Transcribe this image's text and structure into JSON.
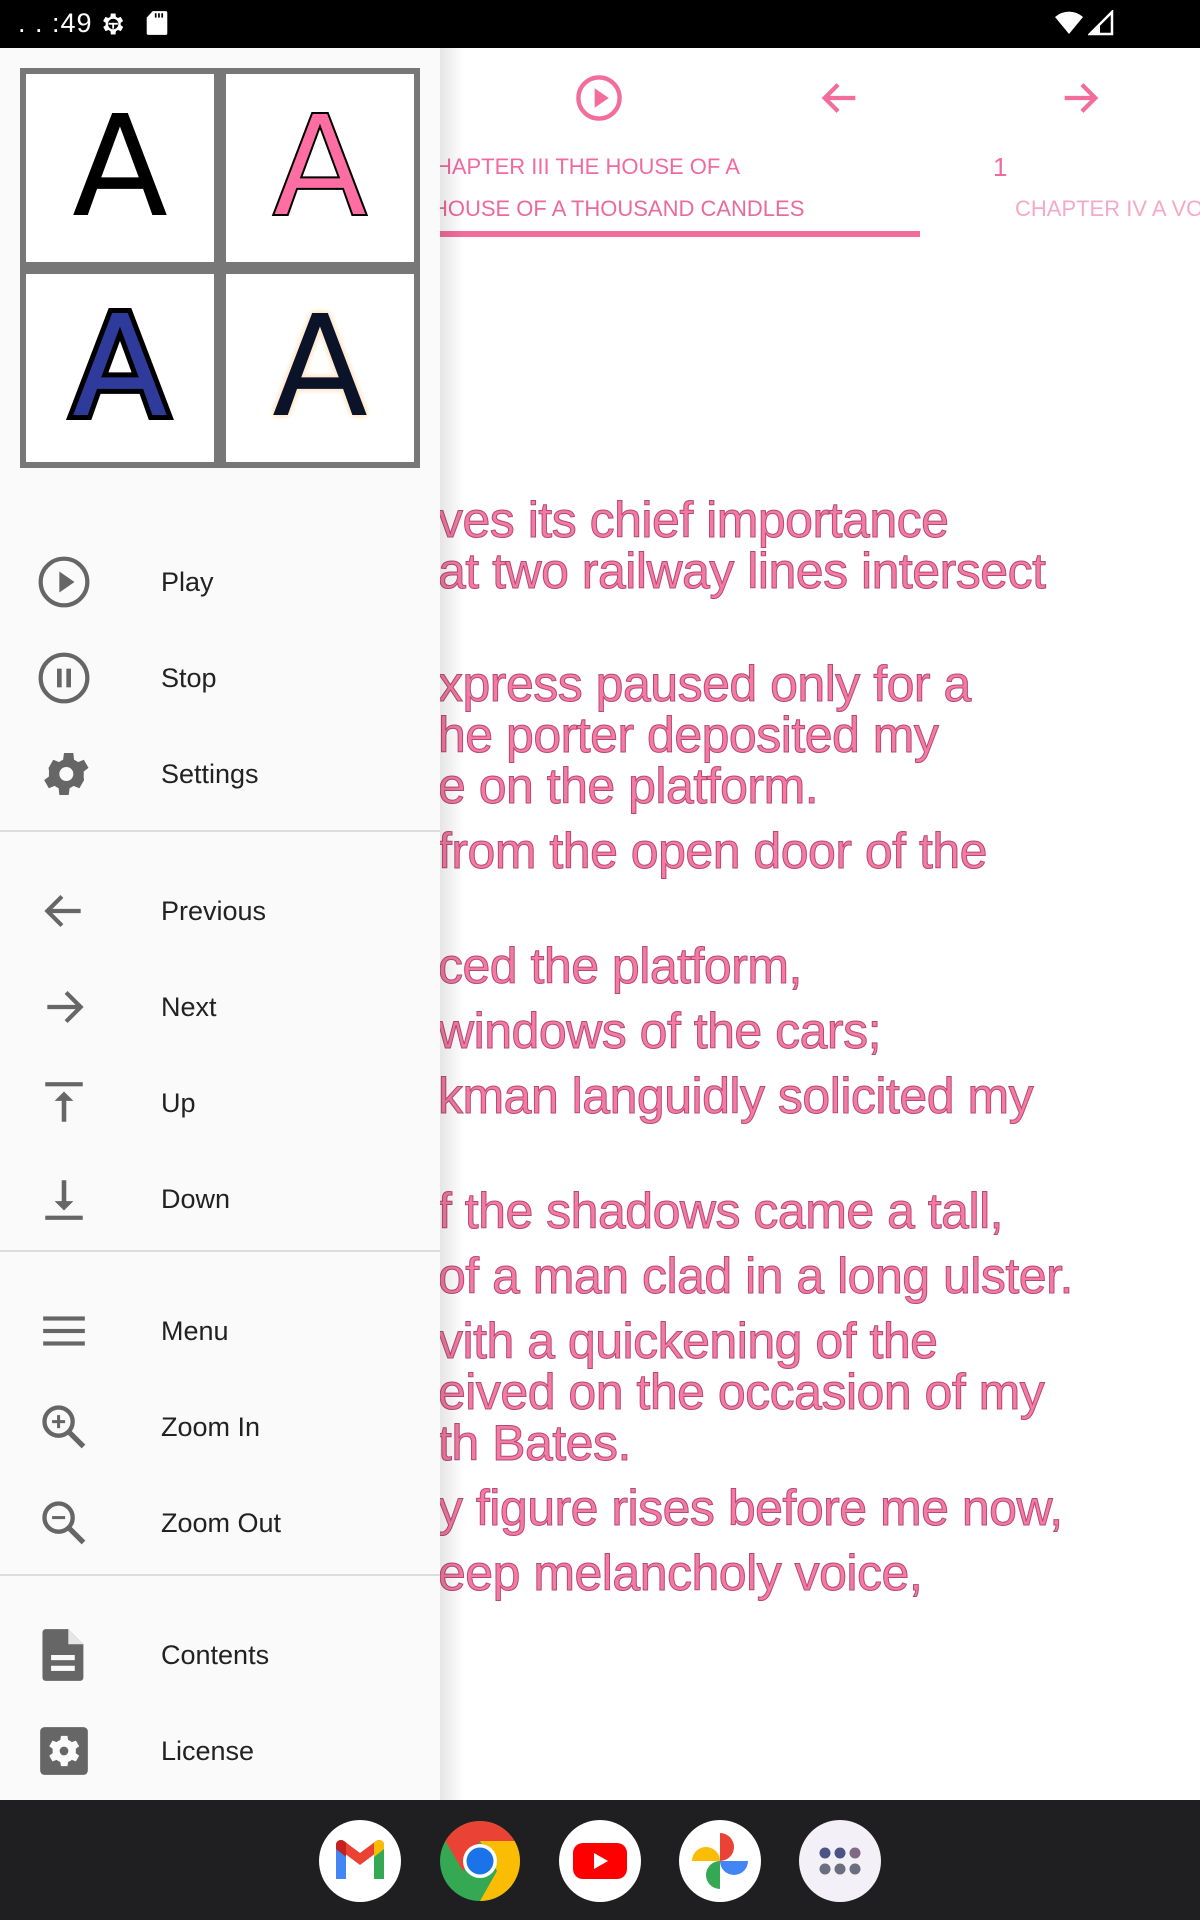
{
  "status_bar": {
    "time": ". . :49",
    "icons": [
      "settings-gear-icon",
      "sd-card-icon",
      "wifi-icon",
      "cell-signal-icon"
    ]
  },
  "reader": {
    "toolbar": {
      "play_icon": "play-circle-icon",
      "previous_icon": "arrow-left-icon",
      "next_icon": "arrow-right-icon"
    },
    "chapter_title": "CHAPTER III THE HOUSE OF A THOUSAND CANDLES",
    "page_number": "1",
    "tabs": [
      {
        "label": "I THE HOUSE OF A THOUSAND CANDLES",
        "selected": true
      },
      {
        "label": "CHAPTER IV A VO",
        "selected": false
      }
    ],
    "lines": [
      "ves its chief importance",
      "at two railway lines intersect",
      "xpress paused only for a",
      "he porter deposited my",
      "e on the platform.",
      " from the open door of the",
      "ced the platform,",
      " windows of the cars;",
      "kman languidly solicited my",
      "f the shadows came a tall,",
      "of a man clad in a long ulster.",
      "vith a quickening of the",
      "eived on the occasion of my",
      "th Bates.",
      "y figure rises before me now,",
      "eep melancholy voice,"
    ],
    "text_color": "#f47aa3",
    "accent_color": "#f26c9c"
  },
  "drawer": {
    "font_styles": [
      {
        "glyph": "A",
        "style": "black"
      },
      {
        "glyph": "A",
        "style": "pink-outlined"
      },
      {
        "glyph": "A",
        "style": "blue-thick-outline"
      },
      {
        "glyph": "A",
        "style": "dark-glow"
      }
    ],
    "groups": [
      [
        {
          "label": "Play",
          "icon": "play-circle-icon"
        },
        {
          "label": "Stop",
          "icon": "pause-circle-icon"
        },
        {
          "label": "Settings",
          "icon": "gear-icon"
        }
      ],
      [
        {
          "label": "Previous",
          "icon": "arrow-left-icon"
        },
        {
          "label": "Next",
          "icon": "arrow-right-icon"
        },
        {
          "label": "Up",
          "icon": "arrow-up-to-line-icon"
        },
        {
          "label": "Down",
          "icon": "arrow-down-to-line-icon"
        }
      ],
      [
        {
          "label": "Menu",
          "icon": "hamburger-menu-icon"
        },
        {
          "label": "Zoom In",
          "icon": "zoom-in-icon"
        },
        {
          "label": "Zoom Out",
          "icon": "zoom-out-icon"
        }
      ],
      [
        {
          "label": "Contents",
          "icon": "document-icon"
        },
        {
          "label": "License",
          "icon": "license-gear-icon"
        }
      ]
    ]
  },
  "dock": {
    "apps": [
      "Gmail",
      "Chrome",
      "YouTube",
      "Photos",
      "App drawer"
    ]
  }
}
